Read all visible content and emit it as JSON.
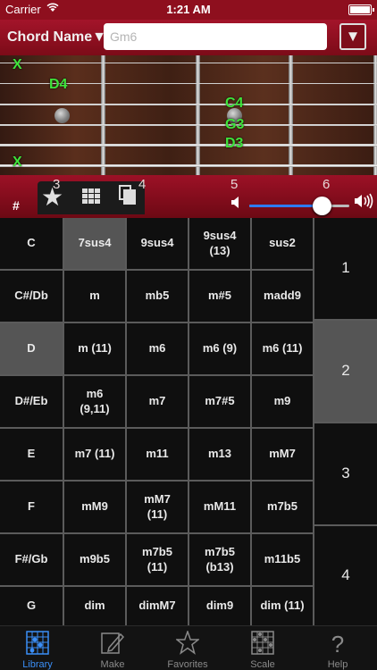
{
  "status_bar": {
    "carrier": "Carrier",
    "time": "1:21 AM"
  },
  "header": {
    "chord_name_label": "Chord Name▼",
    "chord_input_placeholder": "Gm6",
    "dropdown_symbol": "▼"
  },
  "fretboard": {
    "mute_marks": [
      "X",
      "X"
    ],
    "notes": [
      "D4",
      "C4",
      "G3",
      "D3"
    ]
  },
  "controls": {
    "sharp_label": "#",
    "numbers": [
      "3",
      "4",
      "5",
      "6"
    ],
    "volume_level": 0.72,
    "accent_color": "#2d7bf5"
  },
  "roots": [
    "C",
    "C#/Db",
    "D",
    "D#/Eb",
    "E",
    "F",
    "F#/Gb",
    "G"
  ],
  "selected_root": "D",
  "chord_rows": [
    [
      "7sus4",
      "9sus4",
      "9sus4\n(13)",
      "sus2"
    ],
    [
      "m",
      "mb5",
      "m#5",
      "madd9"
    ],
    [
      "m (11)",
      "m6",
      "m6 (9)",
      "m6 (11)"
    ],
    [
      "m6\n(9,11)",
      "m7",
      "m7#5",
      "m9"
    ],
    [
      "m7 (11)",
      "m11",
      "m13",
      "mM7"
    ],
    [
      "mM9",
      "mM7\n(11)",
      "mM11",
      "m7b5"
    ],
    [
      "m9b5",
      "m7b5\n(11)",
      "m7b5\n(b13)",
      "m11b5"
    ],
    [
      "dim",
      "dimM7",
      "dim9",
      "dim (11)"
    ]
  ],
  "selected_chord": "7sus4",
  "pages": [
    "1",
    "2",
    "3",
    "4"
  ],
  "selected_page": "2",
  "tabs": [
    {
      "label": "Library",
      "icon": "library-icon",
      "active": true
    },
    {
      "label": "Make",
      "icon": "make-icon",
      "active": false
    },
    {
      "label": "Favorites",
      "icon": "favorites-icon",
      "active": false
    },
    {
      "label": "Scale",
      "icon": "scale-icon",
      "active": false
    },
    {
      "label": "Help",
      "icon": "help-icon",
      "active": false
    }
  ]
}
